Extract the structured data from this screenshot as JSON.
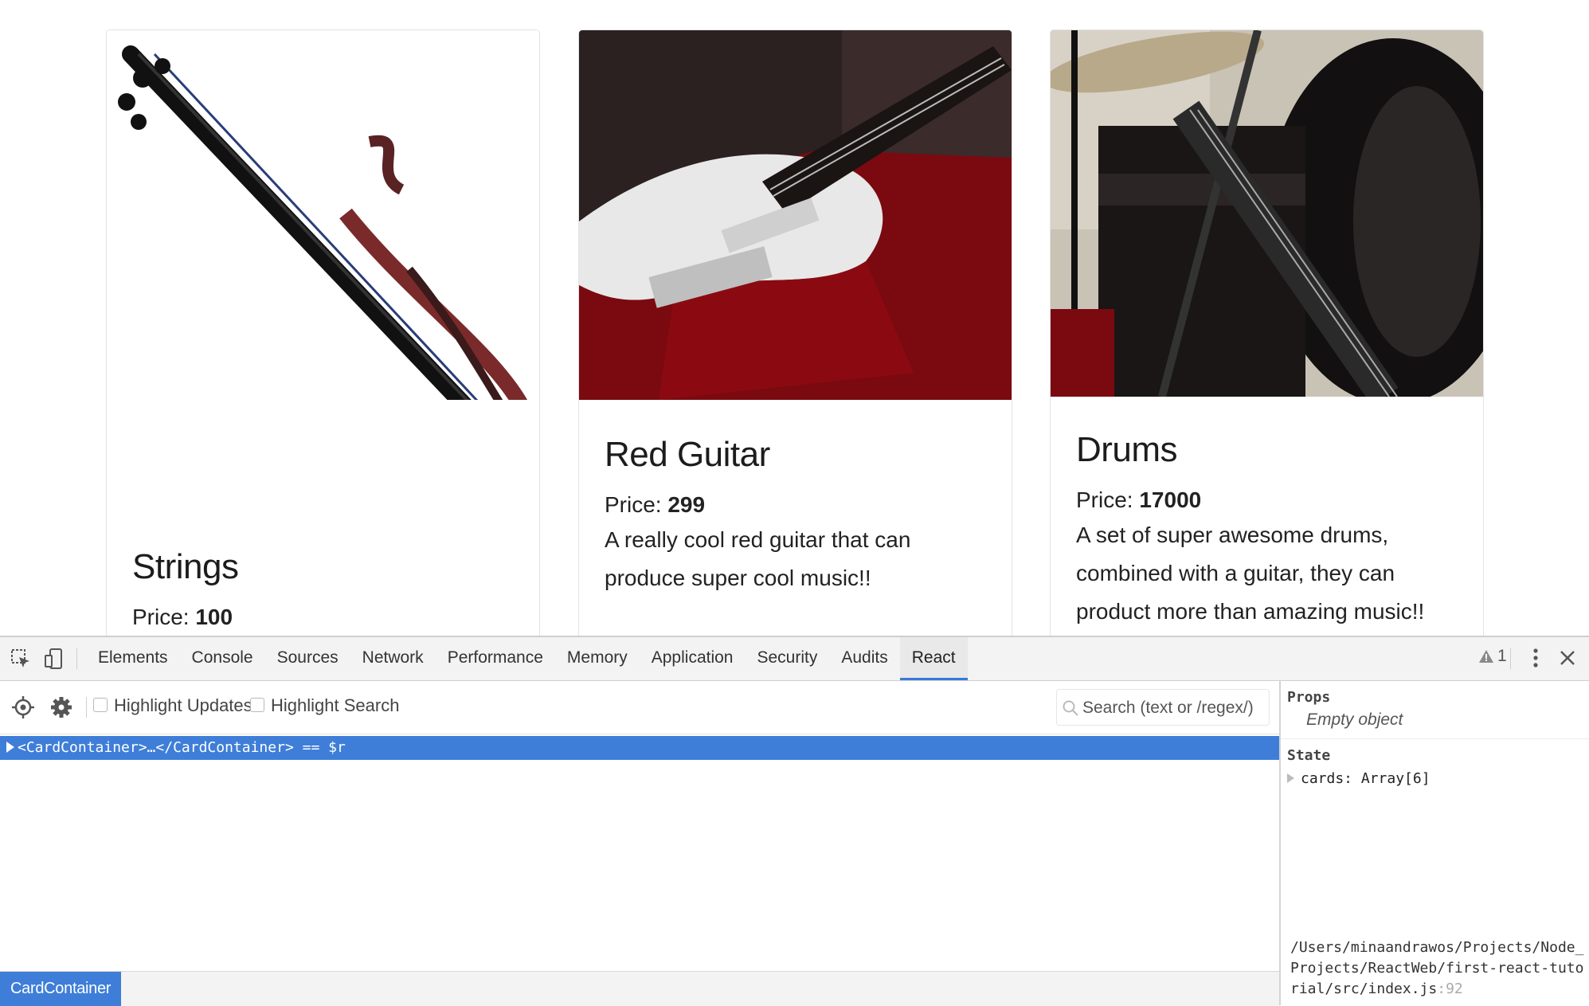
{
  "cards": [
    {
      "title": "Strings",
      "price_label": "Price:",
      "price": "100",
      "description": ""
    },
    {
      "title": "Red Guitar",
      "price_label": "Price:",
      "price": "299",
      "description": "A really cool red guitar that can produce super cool music!!"
    },
    {
      "title": "Drums",
      "price_label": "Price:",
      "price": "17000",
      "description": "A set of super awesome drums, combined with a guitar, they can product more than amazing music!!"
    }
  ],
  "devtools": {
    "tabs": [
      "Elements",
      "Console",
      "Sources",
      "Network",
      "Performance",
      "Memory",
      "Application",
      "Security",
      "Audits",
      "React"
    ],
    "active_tab": "React",
    "warning_count": "1",
    "toolbar": {
      "highlight_updates": "Highlight Updates",
      "highlight_search": "Highlight Search",
      "search_placeholder": "Search (text or /regex/)"
    },
    "tree": {
      "selected_row": "<CardContainer>…</CardContainer> == $r"
    },
    "sidebar": {
      "props_heading": "Props",
      "props_empty": "Empty object",
      "state_heading": "State",
      "state_key": "cards:",
      "state_value": "Array[6]",
      "source_path": "/Users/minaandrawos/Projects/Node_Projects/ReactWeb/first-react-tutorial/src/index.js",
      "source_line": ":92"
    },
    "breadcrumb": "CardContainer"
  },
  "colors": {
    "accent": "#3e7ed8",
    "tab_active_border": "#3879d9"
  }
}
